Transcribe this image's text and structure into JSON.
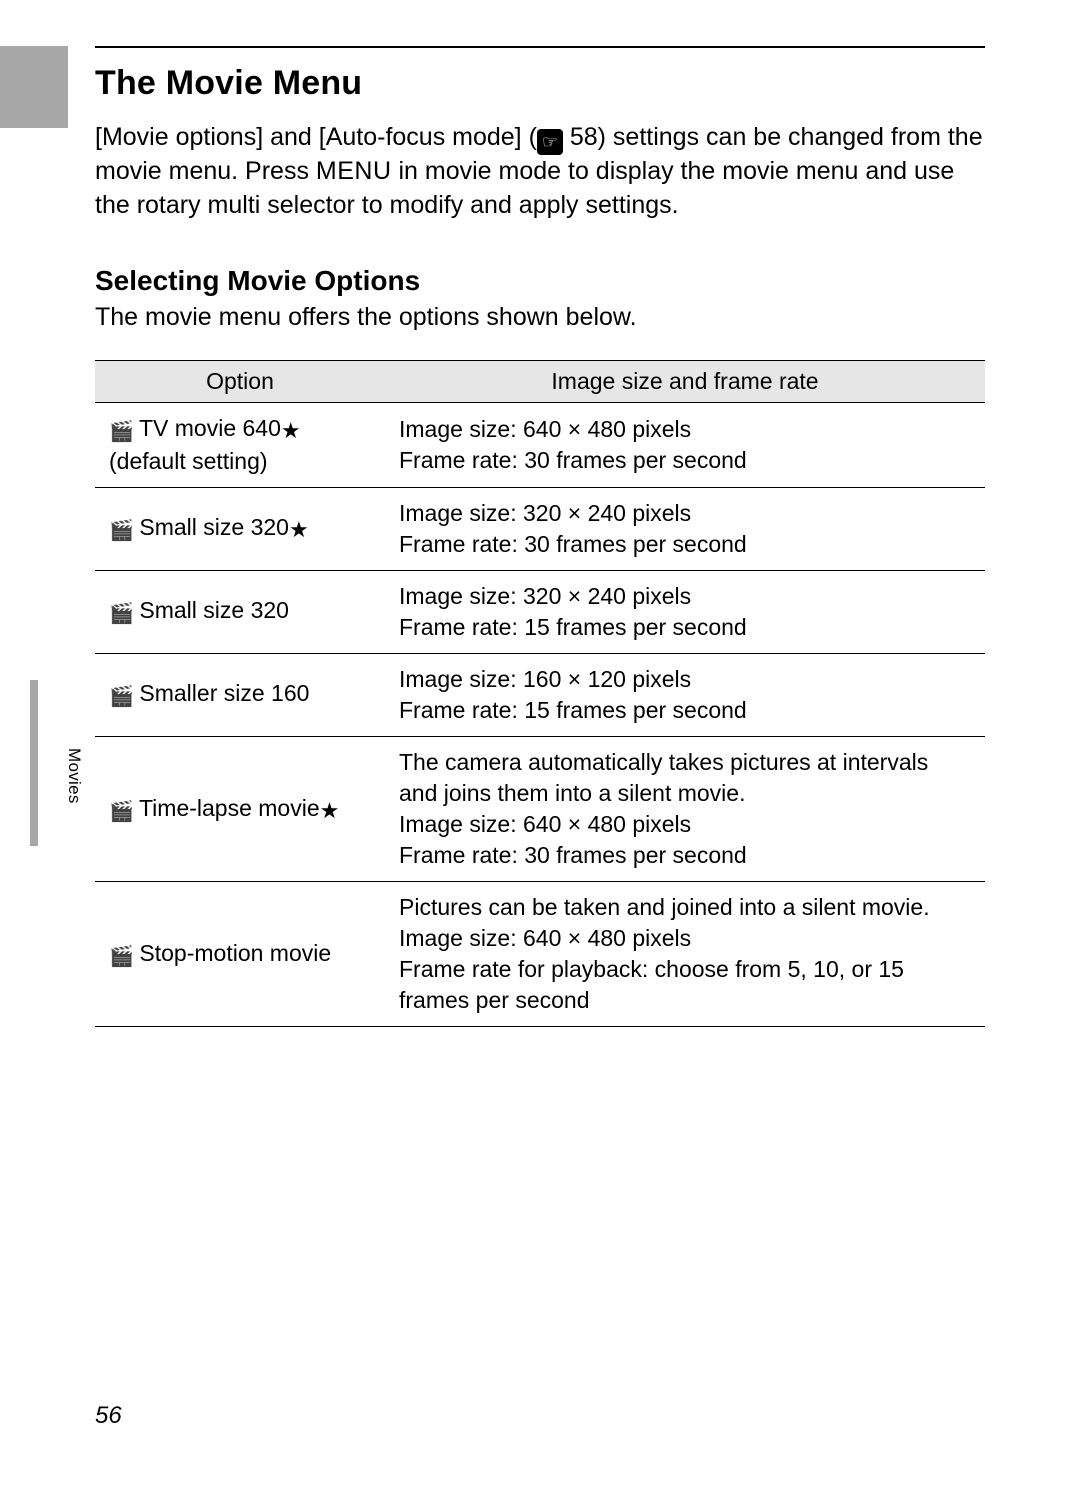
{
  "title": "The Movie Menu",
  "intro": {
    "part1": "[Movie options] and [Auto-focus mode] (",
    "ref_icon": "☞",
    "ref_num": " 58) settings can be changed from the movie menu. Press ",
    "menu_word": "MENU",
    "part2": " in movie mode to display the movie menu and use the rotary multi selector to modify and apply settings."
  },
  "subhead": "Selecting Movie Options",
  "subtext": "The movie menu offers the options shown below.",
  "table": {
    "headers": {
      "option": "Option",
      "desc": "Image size and frame rate"
    },
    "rows": [
      {
        "icon": "🎬",
        "label": "TV movie 640",
        "star": "★",
        "sub": "(default setting)",
        "desc_lines": [
          "Image size: 640 × 480 pixels",
          "Frame rate: 30 frames per second"
        ]
      },
      {
        "icon": "🎬",
        "label": "Small size 320",
        "star": "★",
        "sub": "",
        "desc_lines": [
          "Image size: 320 × 240 pixels",
          "Frame rate: 30 frames per second"
        ]
      },
      {
        "icon": "🎬",
        "label": "Small size 320",
        "star": "",
        "sub": "",
        "desc_lines": [
          "Image size: 320 × 240 pixels",
          "Frame rate: 15 frames per second"
        ]
      },
      {
        "icon": "🎬",
        "label": "Smaller size 160",
        "star": "",
        "sub": "",
        "desc_lines": [
          "Image size: 160 × 120 pixels",
          "Frame rate: 15 frames per second"
        ]
      },
      {
        "icon": "🎬",
        "label": "Time-lapse movie",
        "star": "★",
        "sub": "",
        "desc_lines": [
          "The camera automatically takes pictures at intervals and joins them into a silent movie.",
          "Image size: 640 × 480 pixels",
          "Frame rate: 30 frames per second"
        ]
      },
      {
        "icon": "🎬",
        "label": "Stop-motion movie",
        "star": "",
        "sub": "",
        "desc_lines": [
          "Pictures can be taken and joined into a silent movie.",
          "Image size: 640 × 480 pixels",
          "Frame rate for playback: choose from 5, 10, or 15 frames per second"
        ]
      }
    ]
  },
  "side_label": "Movies",
  "page_number": "56"
}
